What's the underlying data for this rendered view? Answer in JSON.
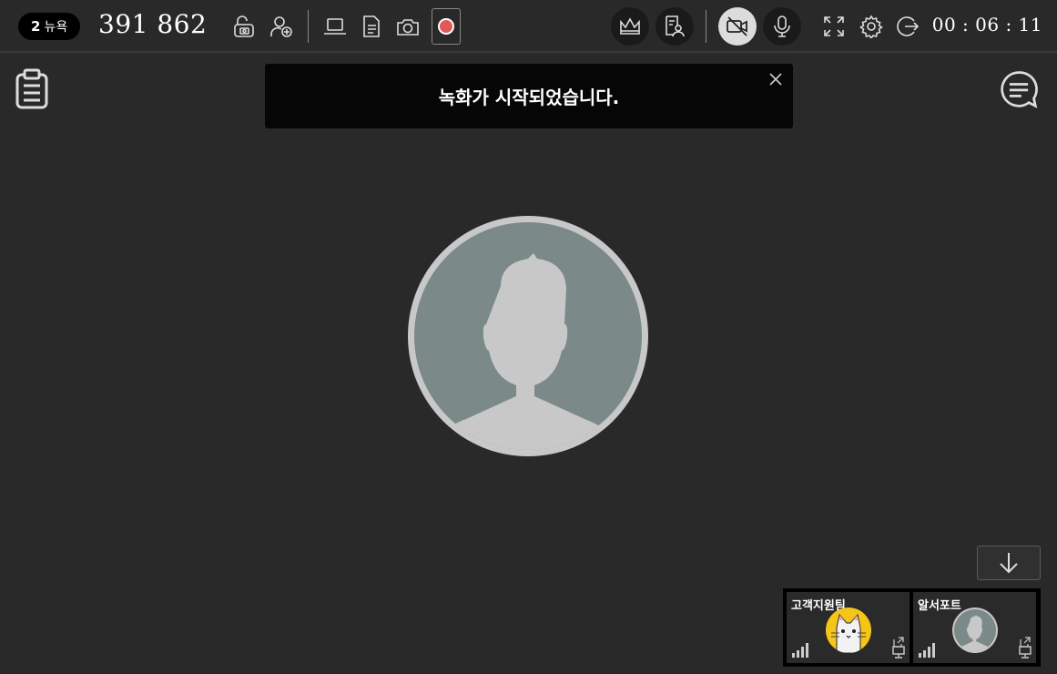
{
  "session": {
    "participant_count": "2",
    "location": "뉴욕"
  },
  "room": {
    "code": "391 862"
  },
  "timer": "00 : 06 : 11",
  "toast": {
    "message": "녹화가 시작되었습니다."
  },
  "participants": [
    {
      "name": "고객지원팀",
      "avatar": "cat-avatar",
      "avatar_color": "#f5c518"
    },
    {
      "name": "알서포트",
      "avatar": "person-avatar",
      "avatar_color": "#7b8989"
    }
  ],
  "icons": {
    "toolbar": [
      "unlock-camera-icon",
      "add-user-icon",
      "laptop-icon",
      "document-icon",
      "camera-icon",
      "record-icon",
      "crown-icon",
      "doc-users-icon",
      "camera-off-icon",
      "microphone-icon",
      "fullscreen-icon",
      "gear-icon",
      "exit-icon"
    ],
    "side": [
      "clipboard-icon",
      "chat-icon"
    ]
  },
  "colors": {
    "record": "#e05a5a",
    "background": "#292929",
    "toast": "#060606"
  }
}
